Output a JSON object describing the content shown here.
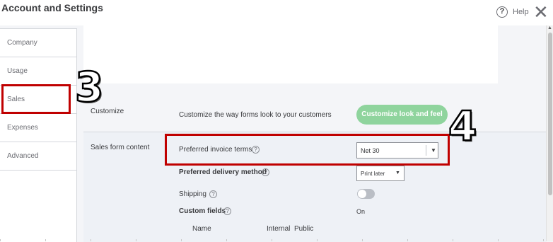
{
  "header": {
    "title": "Account and Settings",
    "help_icon_glyph": "?",
    "help_label": "Help",
    "close_glyph": "✕"
  },
  "sidebar": {
    "items": [
      {
        "label": "Company"
      },
      {
        "label": "Usage"
      },
      {
        "label": "Sales"
      },
      {
        "label": "Expenses"
      },
      {
        "label": "Advanced"
      }
    ],
    "selected": "Sales"
  },
  "customize": {
    "label": "Customize",
    "description": "Customize the way forms look to your customers",
    "button_label": "Customize look and feel"
  },
  "sales_form_content": {
    "label": "Sales form content",
    "info_glyph": "?",
    "invoice_terms": {
      "label": "Preferred invoice terms",
      "value": "Net 30"
    },
    "delivery_method": {
      "label": "Preferred delivery method",
      "value": "Print later"
    },
    "shipping": {
      "label": "Shipping",
      "state": "off"
    },
    "custom_fields": {
      "label": "Custom fields",
      "value": "On"
    },
    "table_headers": [
      "Name",
      "Internal",
      "Public"
    ]
  },
  "annotations": {
    "sales_step": "3",
    "terms_step": "4",
    "color": "#c00000"
  },
  "colors": {
    "accent_green": "#8fd49d",
    "panel_bg": "#eef1f6"
  }
}
